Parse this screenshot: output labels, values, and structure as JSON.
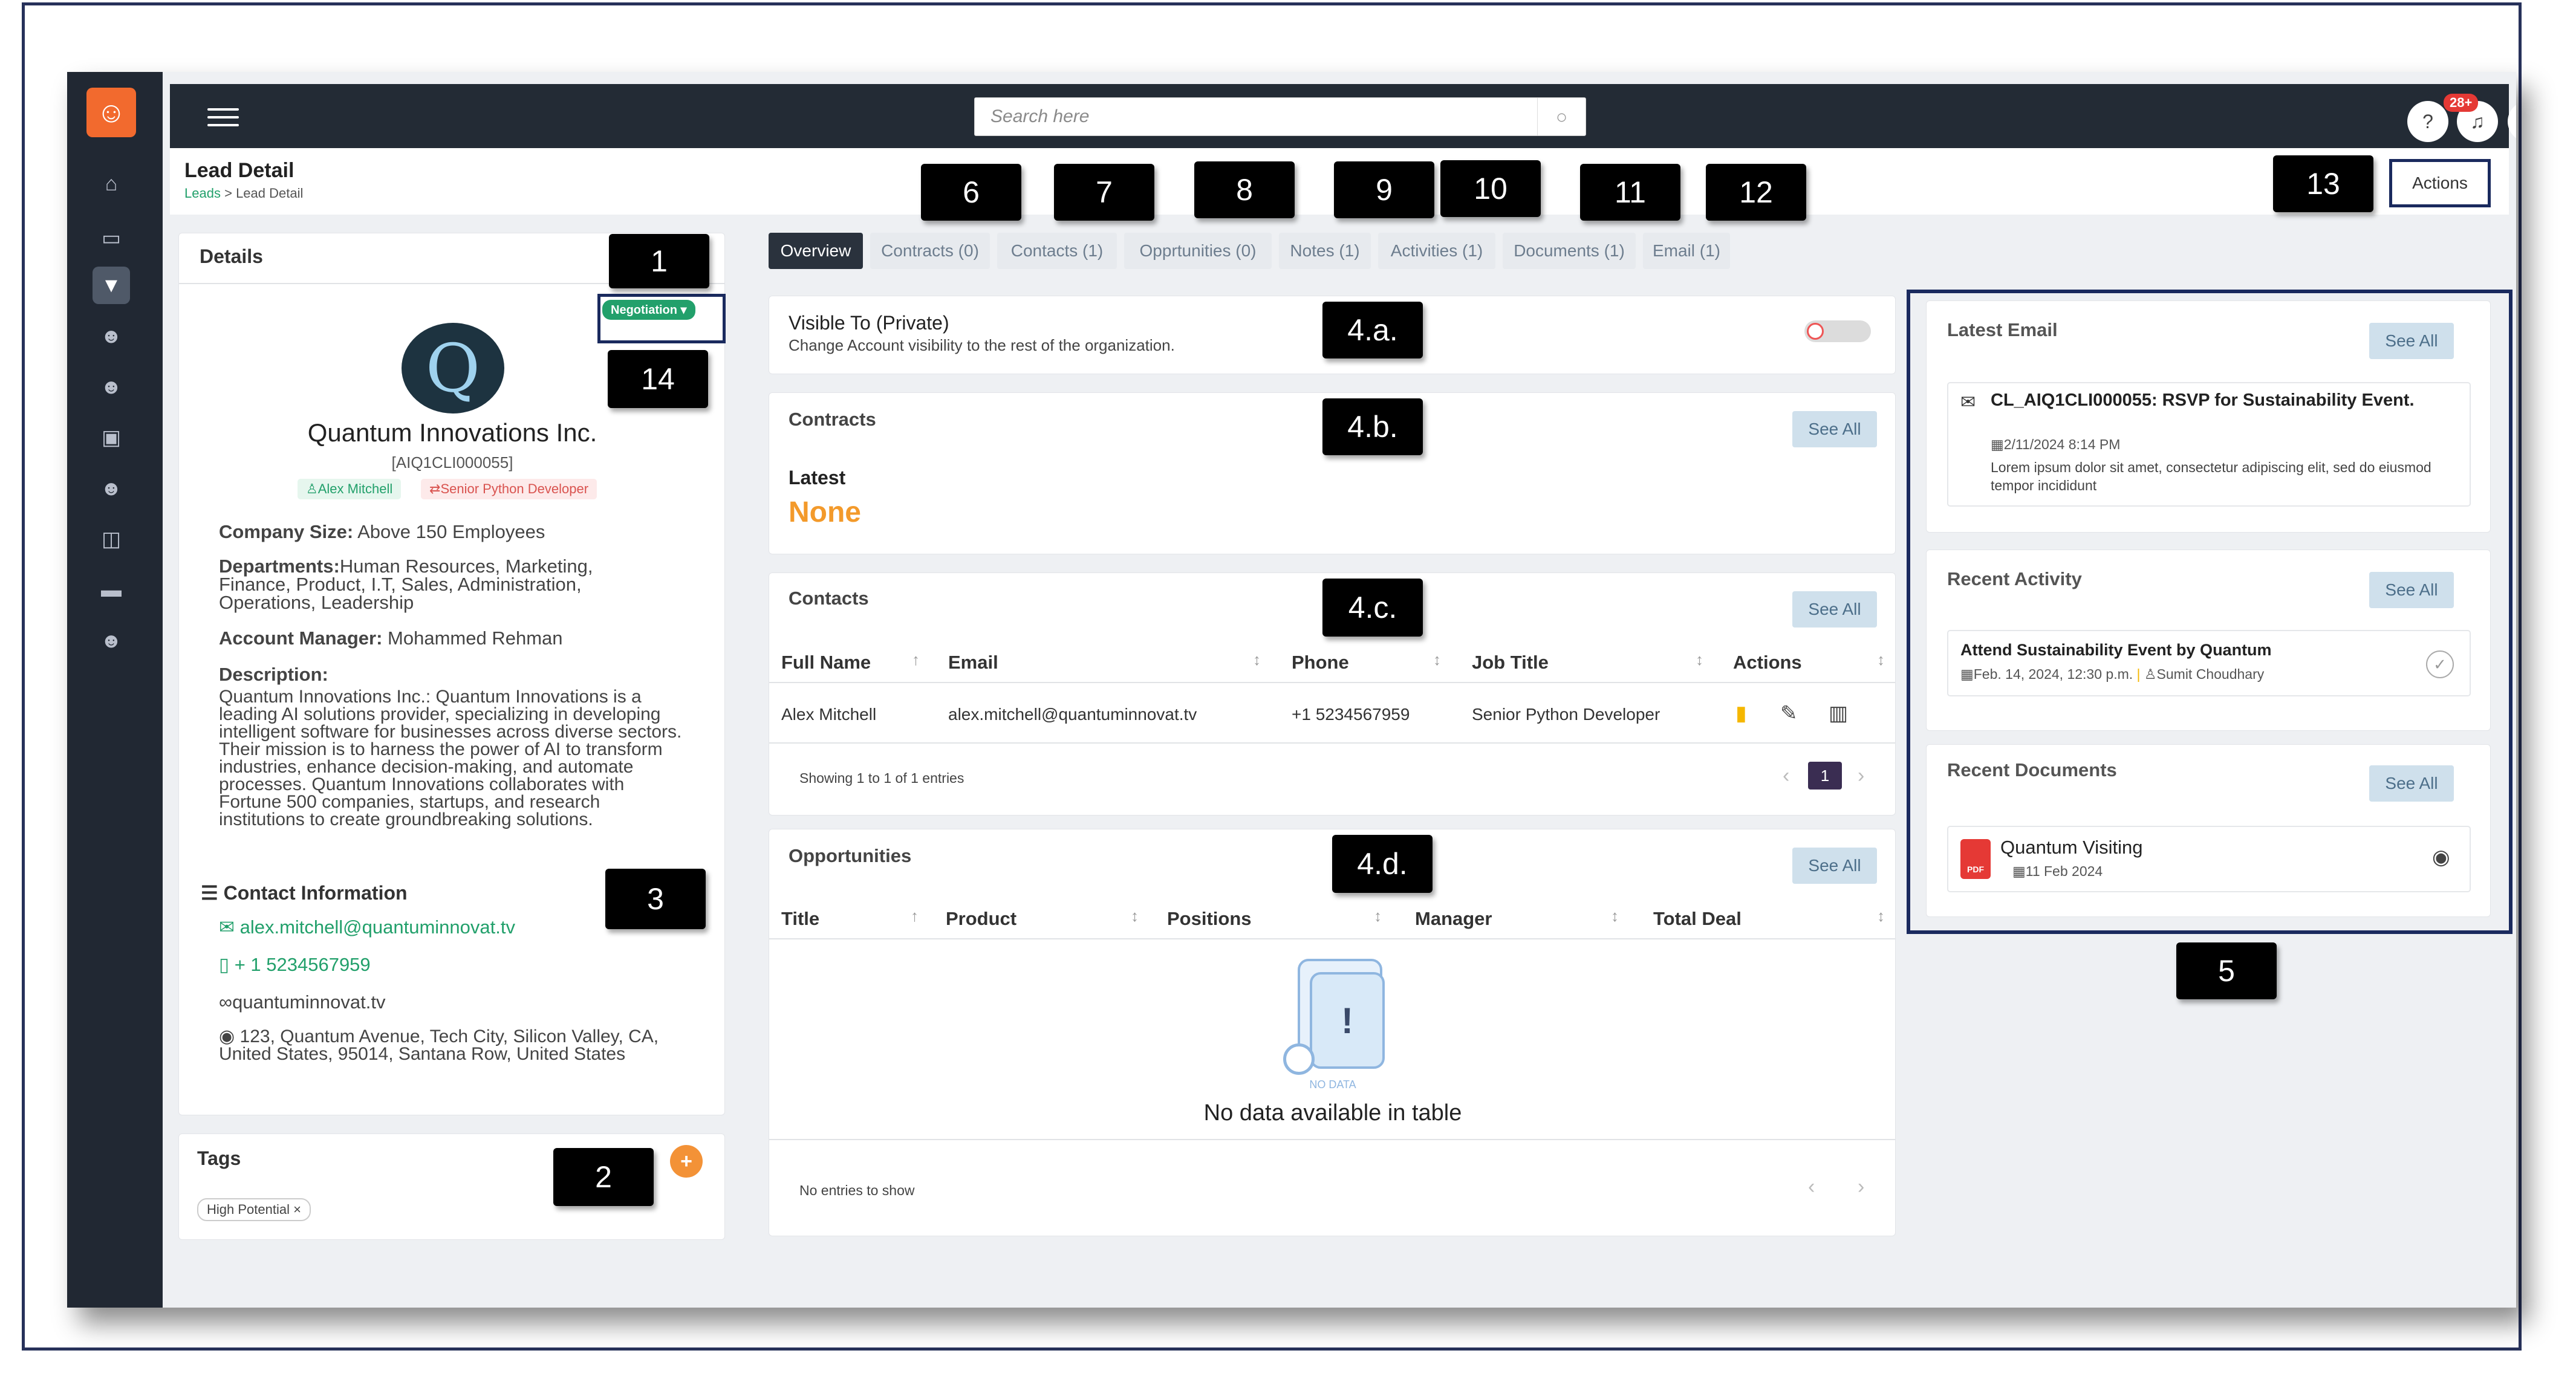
{
  "topbar": {
    "search_placeholder": "Search here",
    "notification_count": "28+"
  },
  "page": {
    "title": "Lead Detail",
    "breadcrumb_link": "Leads",
    "breadcrumb_separator": ">",
    "breadcrumb_current": "Lead Detail",
    "actions_label": "Actions"
  },
  "callouts": {
    "c1": "1",
    "c2": "2",
    "c3": "3",
    "c4a": "4.a.",
    "c4b": "4.b.",
    "c4c": "4.c.",
    "c4d": "4.d.",
    "c5": "5",
    "c6": "6",
    "c7": "7",
    "c8": "8",
    "c9": "9",
    "c10": "10",
    "c11": "11",
    "c12": "12",
    "c13": "13",
    "c14": "14"
  },
  "tabs": [
    {
      "label": "Overview"
    },
    {
      "label": "Contracts (0)"
    },
    {
      "label": "Contacts (1)"
    },
    {
      "label": "Opprtunities (0)"
    },
    {
      "label": "Notes (1)"
    },
    {
      "label": "Activities (1)"
    },
    {
      "label": "Documents (1)"
    },
    {
      "label": "Email (1)"
    }
  ],
  "details": {
    "title": "Details",
    "status": "Negotiation",
    "company_name": "Quantum Innovations Inc.",
    "company_id": "[AIQ1CLI000055]",
    "owner_tag": "Alex Mitchell",
    "role_tag": "Senior Python Developer",
    "company_size_label": "Company Size:",
    "company_size_value": "Above 150 Employees",
    "departments_label": "Departments:",
    "departments_value": "Human Resources, Marketing, Finance, Product, I.T, Sales, Administration, Operations, Leadership",
    "account_manager_label": "Account Manager:",
    "account_manager_value": "Mohammed Rehman",
    "description_label": "Description:",
    "description_value": "Quantum Innovations Inc.: Quantum Innovations is a leading AI solutions provider, specializing in developing intelligent software for businesses across diverse sectors. Their mission is to harness the power of AI to transform industries, enhance decision-making, and automate processes. Quantum Innovations collaborates with Fortune 500 companies, startups, and research institutions to create groundbreaking solutions.",
    "contact_info_title": "Contact Information",
    "email": "alex.mitchell@quantuminnovat.tv",
    "phone": "+ 1 5234567959",
    "website": "quantuminnovat.tv",
    "address": "123, Quantum Avenue, Tech City, Silicon Valley, CA, United States, 95014, Santana Row, United States"
  },
  "tags": {
    "title": "Tags",
    "items": [
      "High Potential"
    ],
    "remove_glyph": "×"
  },
  "visibility": {
    "title": "Visible To (Private)",
    "subtitle": "Change Account visibility to the rest of the organization."
  },
  "contracts": {
    "title": "Contracts",
    "see_all": "See All",
    "latest_label": "Latest",
    "latest_value": "None"
  },
  "contacts": {
    "title": "Contacts",
    "see_all": "See All",
    "columns": [
      "Full Name",
      "Email",
      "Phone",
      "Job Title",
      "Actions"
    ],
    "rows": [
      {
        "full_name": "Alex Mitchell",
        "email": "alex.mitchell@quantuminnovat.tv",
        "phone": "+1 5234567959",
        "job_title": "Senior Python Developer"
      }
    ],
    "footer": "Showing 1 to 1 of 1 entries",
    "current_page": "1"
  },
  "opportunities": {
    "title": "Opportunities",
    "see_all": "See All",
    "columns": [
      "Title",
      "Product",
      "Positions",
      "Manager",
      "Total Deal"
    ],
    "no_data_caption": "NO DATA",
    "empty_message": "No data available in table",
    "footer": "No entries to show"
  },
  "latest_email": {
    "title": "Latest Email",
    "see_all": "See All",
    "subject": "CL_AIQ1CLI000055: RSVP for Sustainability Event.",
    "date": "2/11/2024 8:14 PM",
    "snippet": "Lorem ipsum dolor sit amet, consectetur adipiscing elit, sed do eiusmod tempor incididunt"
  },
  "recent_activity": {
    "title": "Recent Activity",
    "see_all": "See All",
    "item_title": "Attend Sustainability Event by Quantum",
    "item_date": "Feb. 14, 2024, 12:30 p.m.",
    "item_owner": "Sumit Choudhary"
  },
  "recent_documents": {
    "title": "Recent Documents",
    "see_all": "See All",
    "doc_name": "Quantum Visiting",
    "doc_date": "11 Feb 2024",
    "file_badge": "PDF"
  },
  "colors": {
    "sidebar": "#212833",
    "topbar": "#232b35",
    "accent_green": "#22a06b",
    "accent_orange": "#f39237",
    "none_orange": "#f39a2b"
  }
}
